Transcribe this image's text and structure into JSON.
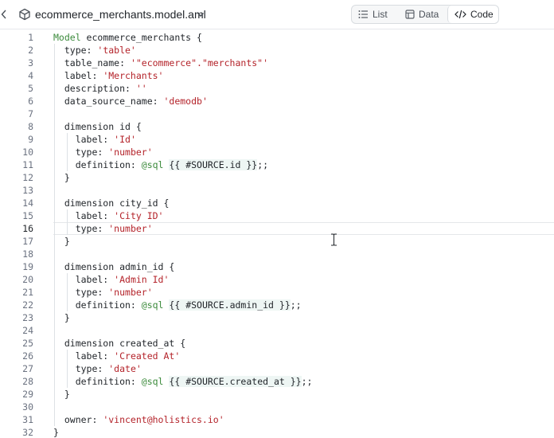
{
  "header": {
    "file_name": "ecommerce_merchants.model.aml",
    "tabs": [
      {
        "label": "List",
        "icon": "list-icon"
      },
      {
        "label": "Data",
        "icon": "table-icon"
      },
      {
        "label": "Code",
        "icon": "code-icon",
        "active": true
      }
    ]
  },
  "editor": {
    "active_line": 16,
    "lines": [
      {
        "n": "1",
        "text": "Model ecommerce_merchants {"
      },
      {
        "n": "2",
        "text": "  type: 'table'"
      },
      {
        "n": "3",
        "text": "  table_name: '\"ecommerce\".\"merchants\"'"
      },
      {
        "n": "4",
        "text": "  label: 'Merchants'"
      },
      {
        "n": "5",
        "text": "  description: ''"
      },
      {
        "n": "6",
        "text": "  data_source_name: 'demodb'"
      },
      {
        "n": "7",
        "text": ""
      },
      {
        "n": "8",
        "text": "  dimension id {"
      },
      {
        "n": "9",
        "text": "    label: 'Id'"
      },
      {
        "n": "10",
        "text": "    type: 'number'"
      },
      {
        "n": "11",
        "text": "    definition: @sql {{ #SOURCE.id }};;"
      },
      {
        "n": "12",
        "text": "  }"
      },
      {
        "n": "13",
        "text": ""
      },
      {
        "n": "14",
        "text": "  dimension city_id {"
      },
      {
        "n": "15",
        "text": "    label: 'City ID'"
      },
      {
        "n": "16",
        "text": "    type: 'number'"
      },
      {
        "n": "17",
        "text": "  }"
      },
      {
        "n": "18",
        "text": ""
      },
      {
        "n": "19",
        "text": "  dimension admin_id {"
      },
      {
        "n": "20",
        "text": "    label: 'Admin Id'"
      },
      {
        "n": "21",
        "text": "    type: 'number'"
      },
      {
        "n": "22",
        "text": "    definition: @sql {{ #SOURCE.admin_id }};;"
      },
      {
        "n": "23",
        "text": "  }"
      },
      {
        "n": "24",
        "text": ""
      },
      {
        "n": "25",
        "text": "  dimension created_at {"
      },
      {
        "n": "26",
        "text": "    label: 'Created At'"
      },
      {
        "n": "27",
        "text": "    type: 'date'"
      },
      {
        "n": "28",
        "text": "    definition: @sql {{ #SOURCE.created_at }};;"
      },
      {
        "n": "29",
        "text": "  }"
      },
      {
        "n": "30",
        "text": ""
      },
      {
        "n": "31",
        "text": "  owner: 'vincent@holistics.io'"
      },
      {
        "n": "32",
        "text": "}"
      }
    ]
  },
  "colors": {
    "keyword": "#3b8a3b",
    "string": "#b4232a",
    "sql_bg": "#eef6f4"
  }
}
